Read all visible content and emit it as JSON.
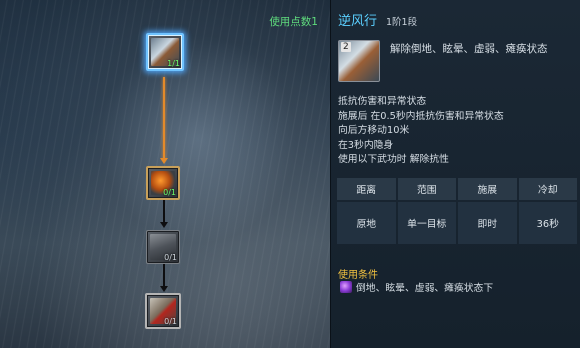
{
  "tree": {
    "points_label": "使用点数1",
    "nodes": [
      {
        "level": "1/1"
      },
      {
        "level": "0/1"
      },
      {
        "level": "0/1"
      },
      {
        "level": "0/1"
      }
    ]
  },
  "skill": {
    "name": "逆风行",
    "level_text": "1阶1段",
    "icon_badge": "2",
    "summary": "解除倒地、眩晕、虚弱、瘫痪状态",
    "description": [
      "抵抗伤害和异常状态",
      "施展后 在0.5秒内抵抗伤害和异常状态",
      "向后方移动10米",
      "在3秒内隐身",
      "使用以下武功时 解除抗性"
    ],
    "stats": {
      "headers": [
        "距离",
        "范围",
        "施展",
        "冷却"
      ],
      "values": [
        "原地",
        "单一目标",
        "即时",
        "36秒"
      ]
    },
    "condition": {
      "title": "使用条件",
      "text": "倒地、眩晕、虚弱、瘫痪状态下"
    }
  },
  "colors": {
    "skill_name": "#5bd0ff",
    "points": "#5fdc7d",
    "condition_title": "#f0c040",
    "link_active": "#e38a2a",
    "selected_glow": "#6fc3ff"
  }
}
